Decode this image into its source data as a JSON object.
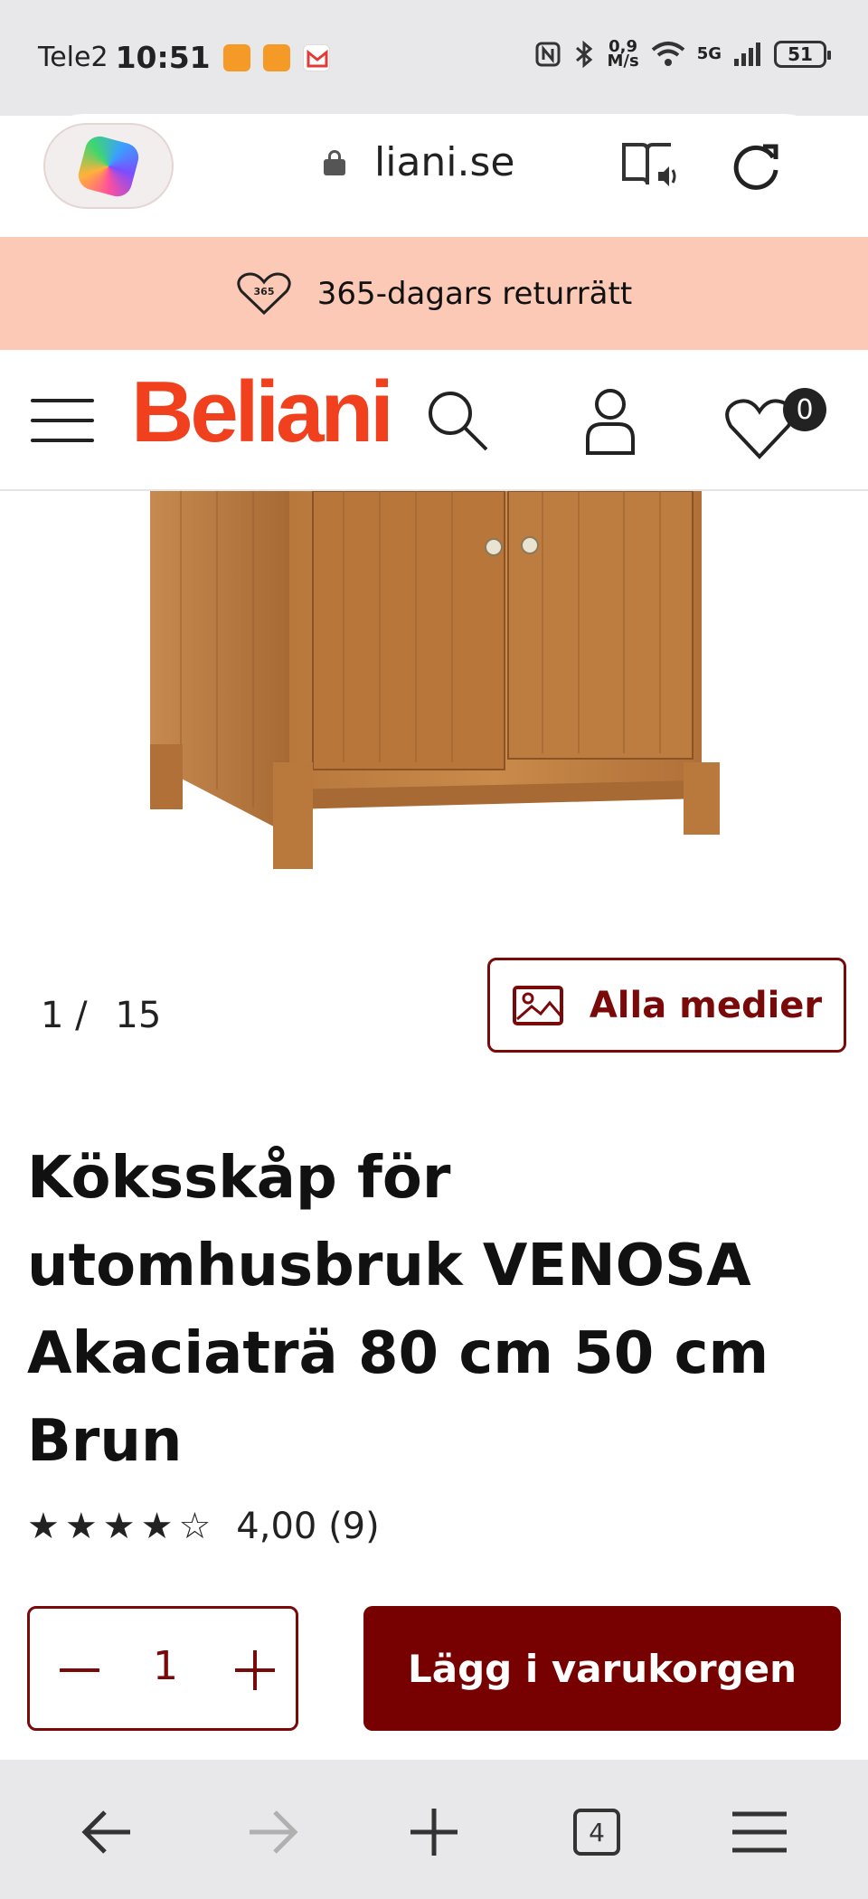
{
  "status_bar": {
    "carrier": "Tele2",
    "time": "10:51",
    "data_rate_top": "0,9",
    "data_rate_bottom": "M/s",
    "network": "5G",
    "battery": "51"
  },
  "browser": {
    "url": "liani.se",
    "tab_count": "4"
  },
  "promo": {
    "badge": "365",
    "text": "365-dagars returrätt"
  },
  "header": {
    "logo": "Beliani",
    "wishlist_count": "0"
  },
  "gallery": {
    "current": "1",
    "separator": "/",
    "total": "15",
    "all_media_label": "Alla medier"
  },
  "product": {
    "title": "Köksskåp för utomhusbruk VENOSA Akaciaträ 80 cm 50 cm Brun",
    "rating_value": 4.0,
    "rating_text": "4,00 (9)",
    "stars_max": 5
  },
  "purchase": {
    "quantity": "1",
    "add_to_cart_label": "Lägg i varukorgen"
  },
  "colors": {
    "brand": "#f0401d",
    "accent": "#770000",
    "promo_bg": "#fcc9b6"
  }
}
